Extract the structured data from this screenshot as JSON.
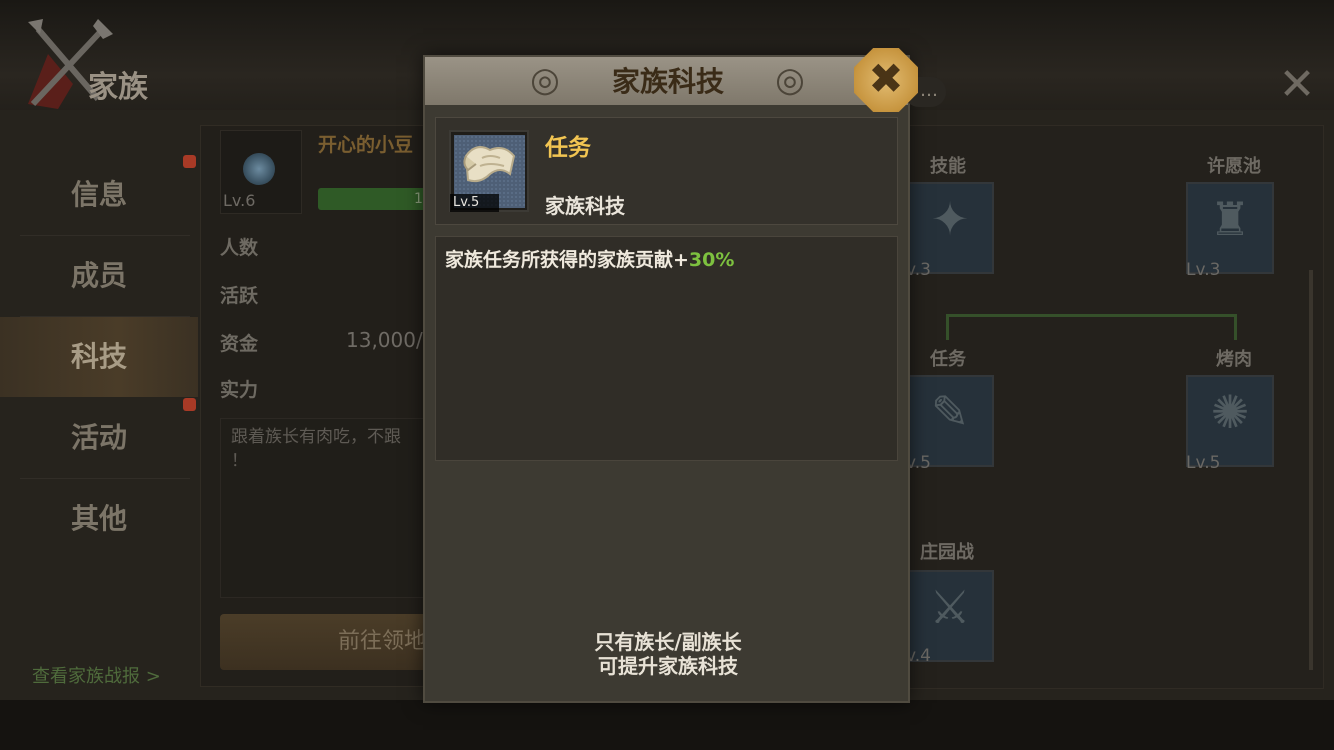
{
  "screen": {
    "title": "家族",
    "nav": [
      {
        "label": "信息",
        "badge": true
      },
      {
        "label": "成员",
        "badge": false
      },
      {
        "label": "科技",
        "badge": false,
        "active": true
      },
      {
        "label": "活动",
        "badge": true
      },
      {
        "label": "其他",
        "badge": false
      }
    ],
    "battle_report_link": "查看家族战报 >"
  },
  "info": {
    "family_name": "开心的小豆",
    "badge_level": "Lv.6",
    "exp_text": "1",
    "labels": {
      "members": "人数",
      "active": "活跃",
      "funds": "资金",
      "strength": "实力"
    },
    "funds_value": "13,000/",
    "notice": "跟着族长有肉吃，不跟\n！",
    "goto_button": "前往领地"
  },
  "tree": {
    "nodes": [
      {
        "label": "技能",
        "level": "v.3"
      },
      {
        "label": "许愿池",
        "level": "Lv.3"
      },
      {
        "label": "任务",
        "level": "v.5"
      },
      {
        "label": "烤肉",
        "level": "Lv.5"
      },
      {
        "label": "庄园战",
        "level": "v.4"
      }
    ]
  },
  "modal": {
    "title": "家族科技",
    "skill": {
      "name": "任务",
      "category": "家族科技",
      "level": "Lv.5"
    },
    "description": {
      "text": "家族任务所获得的家族贡献+",
      "bonus": "30%",
      "bonus_color": "#7dc13f"
    },
    "footer_line1": "只有族长/副族长",
    "footer_line2": "可提升家族科技"
  },
  "colors": {
    "title_gold": "#f2c552",
    "close_button": "#c7953f"
  }
}
